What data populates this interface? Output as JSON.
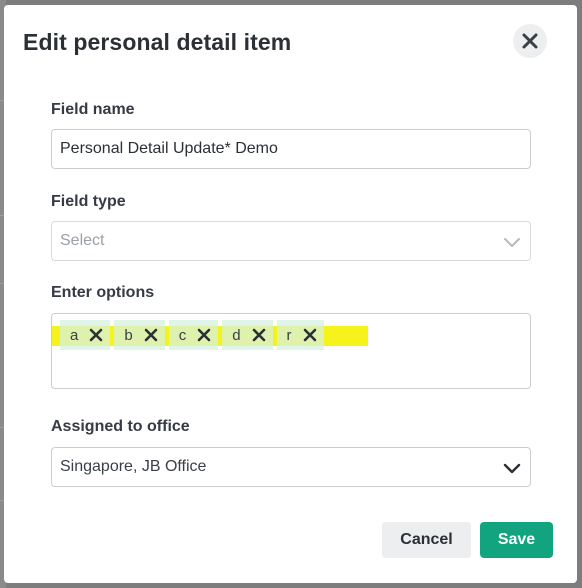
{
  "dialog": {
    "title": "Edit personal detail item",
    "close_icon": "close-icon"
  },
  "field_name": {
    "label": "Field name",
    "value": "Personal Detail Update* Demo"
  },
  "field_type": {
    "label": "Field type",
    "placeholder": "Select"
  },
  "options": {
    "label": "Enter options",
    "items": [
      {
        "label": "a"
      },
      {
        "label": "b"
      },
      {
        "label": "c"
      },
      {
        "label": "d"
      },
      {
        "label": "r"
      }
    ]
  },
  "office": {
    "label": "Assigned to office",
    "value": "Singapore, JB Office"
  },
  "buttons": {
    "cancel": "Cancel",
    "save": "Save"
  },
  "colors": {
    "primary": "#12a47f",
    "highlight": "#f6f21b",
    "chip_bg": "#d6f0df"
  }
}
